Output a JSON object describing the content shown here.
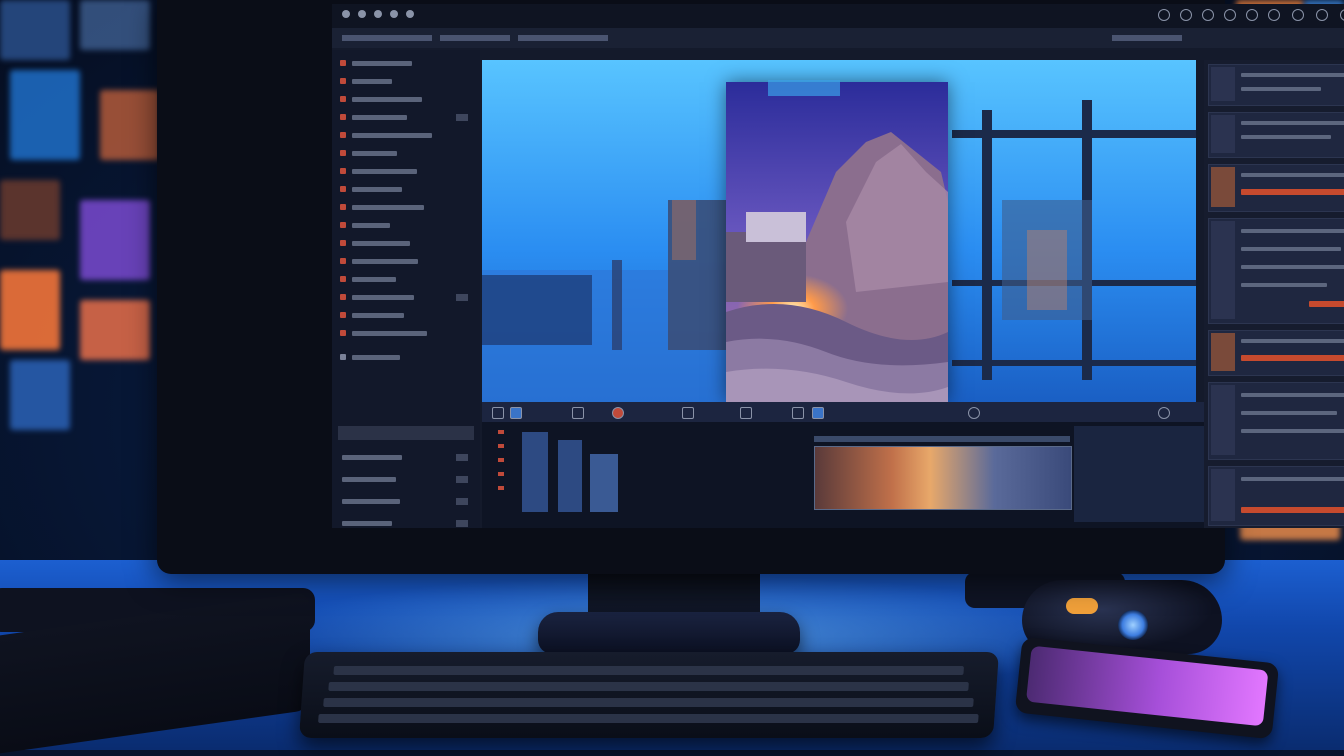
{
  "scene": {
    "subject": "",
    "colors": {
      "accent": "#2a8cf0",
      "bezel": "#0a0d17",
      "desk": "#1147ac",
      "phone_glow": "#e277ff",
      "ui_dark": "#141a2b"
    }
  },
  "editor": {
    "preview_title": "",
    "timeline_label": ""
  },
  "icons": [
    "settings-icon",
    "play-icon",
    "pause-icon",
    "record-icon",
    "layers-icon",
    "search-icon",
    "close-icon",
    "maximize-icon",
    "minimize-icon"
  ]
}
